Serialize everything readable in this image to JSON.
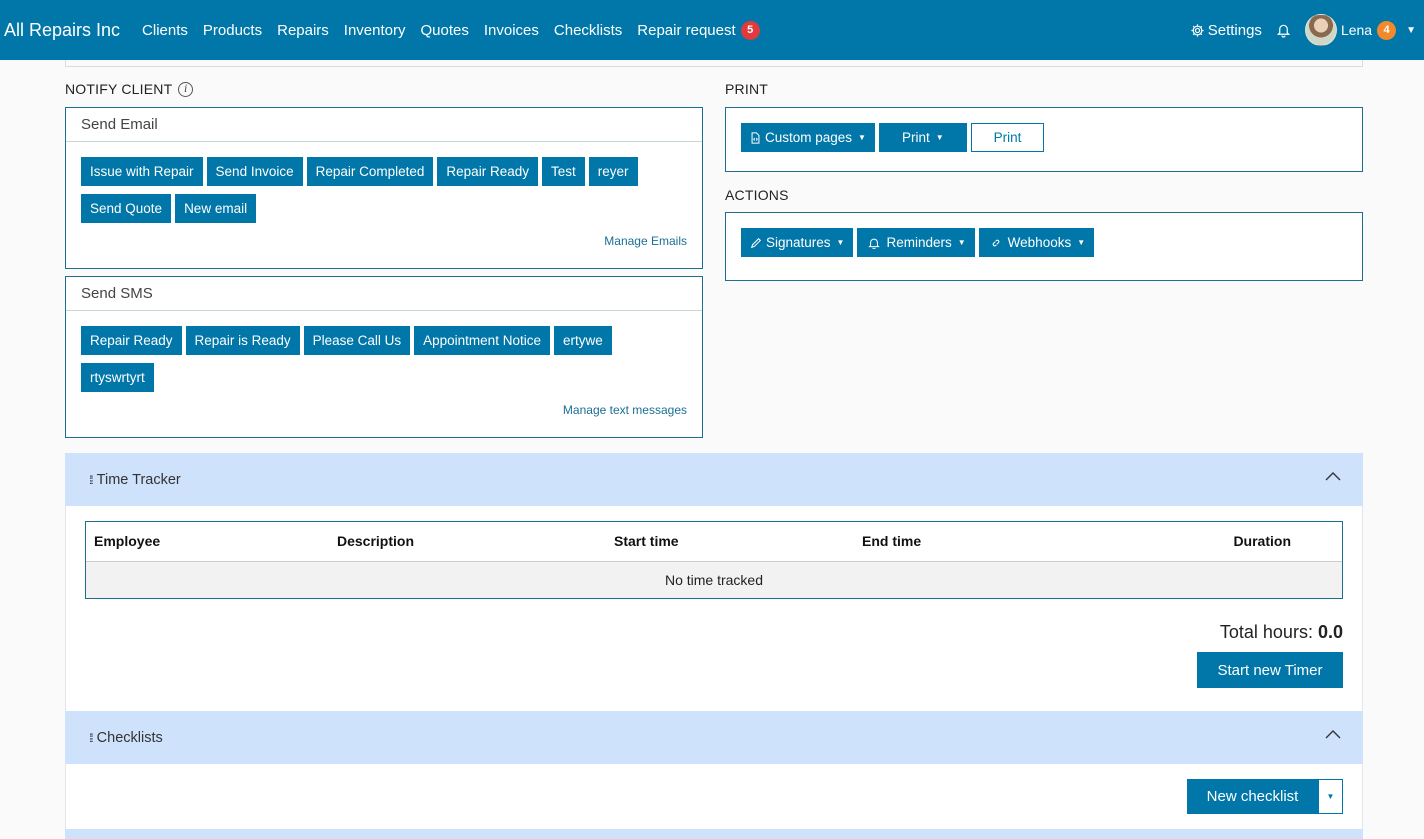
{
  "nav": {
    "brand": "All Repairs Inc",
    "links": [
      "Clients",
      "Products",
      "Repairs",
      "Inventory",
      "Quotes",
      "Invoices",
      "Checklists"
    ],
    "repair_request": "Repair request",
    "repair_request_count": "5",
    "settings": "Settings",
    "user_name": "Lena",
    "user_badge": "4"
  },
  "notify": {
    "title": "NOTIFY CLIENT",
    "email": {
      "header": "Send Email",
      "row1": [
        "Issue with Repair",
        "Send Invoice",
        "Repair Completed",
        "Repair Ready",
        "Test",
        "reyer"
      ],
      "row2": [
        "Send Quote",
        "New email"
      ],
      "manage": "Manage Emails"
    },
    "sms": {
      "header": "Send SMS",
      "row1": [
        "Repair Ready",
        "Repair is Ready",
        "Please Call Us",
        "Appointment Notice",
        "ertywe"
      ],
      "row2": [
        "rtyswrtyrt"
      ],
      "manage": "Manage text messages"
    }
  },
  "print": {
    "title": "PRINT",
    "custom_pages": "Custom pages",
    "print_dropdown": "Print",
    "print_button": "Print"
  },
  "actions": {
    "title": "ACTIONS",
    "signatures": "Signatures",
    "reminders": "Reminders",
    "webhooks": "Webhooks"
  },
  "time_tracker": {
    "title": "Time Tracker",
    "columns": [
      "Employee",
      "Description",
      "Start time",
      "End time",
      "Duration"
    ],
    "empty": "No time tracked",
    "total_label": "Total hours:",
    "total_value": "0.0",
    "start_button": "Start new Timer"
  },
  "checklists": {
    "title": "Checklists",
    "new_button": "New checklist"
  },
  "colors": {
    "primary": "#0077a8",
    "panel_header": "#cfe2fb",
    "badge_red": "#e03a3a",
    "badge_orange": "#f28a2b"
  }
}
